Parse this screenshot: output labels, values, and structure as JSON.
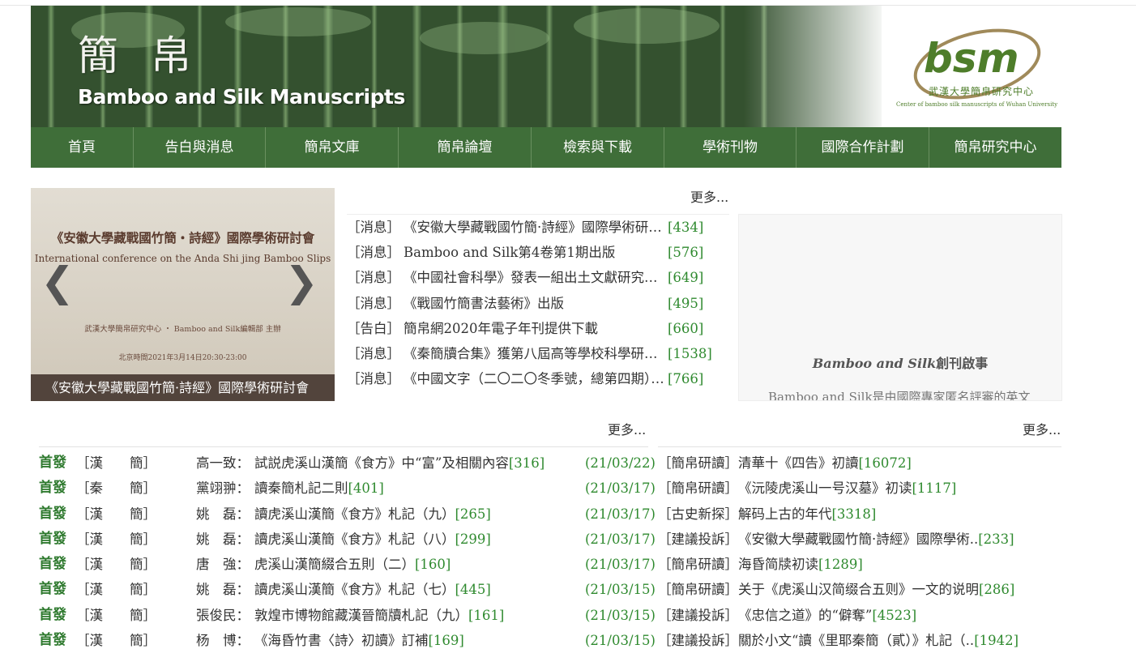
{
  "banner": {
    "title_cn": "簡帛",
    "title_en": "Bamboo and Silk Manuscripts",
    "logo_text": "bsm",
    "logo_cn": "武漢大學簡帛研究中心",
    "logo_en": "Center of bamboo silk manuscripts of Wuhan University"
  },
  "nav": [
    "首頁",
    "告白與消息",
    "簡帛文庫",
    "簡帛論壇",
    "檢索與下載",
    "學術刊物",
    "國際合作計劃",
    "簡帛研究中心"
  ],
  "slider": {
    "title": "《安徽大學藏戰國竹簡・詩經》國際學術研討會",
    "subtitle": "International conference on the Anda Shi jing Bamboo Slips",
    "org": "武漢大學簡帛研究中心 ・ Bamboo and Silk編輯部 主辦",
    "time": "北京時間2021年3月14日20:30-23:00",
    "caption": "《安徽大學藏戰國竹簡·詩經》國際學術研討會",
    "prev": "❮",
    "next": "❯"
  },
  "news": {
    "more": "更多...",
    "items": [
      {
        "tag": "［消息］",
        "title": "《安徽大學藏戰國竹簡·詩經》國際學術研討會",
        "count": "[434]"
      },
      {
        "tag": "［消息］",
        "title": "Bamboo and Silk第4卷第1期出版",
        "count": "[576]"
      },
      {
        "tag": "［消息］",
        "title": "《中國社會科學》發表一組出土文獻研究論文",
        "count": "[649]"
      },
      {
        "tag": "［消息］",
        "title": "《戰國竹簡書法藝術》出版",
        "count": "[495]"
      },
      {
        "tag": "［告白］",
        "title": "簡帛網2020年電子年刊提供下載",
        "count": "[660]"
      },
      {
        "tag": "［消息］",
        "title": "《秦簡牘合集》獲第八屆高等學校科學研究優秀成果獎",
        "count": "[1538]"
      },
      {
        "tag": "［消息］",
        "title": "《中國文字（二〇二〇冬季號，總第四期）》出版",
        "count": "[766]"
      }
    ]
  },
  "notice": {
    "title_italic": "Bamboo and Silk",
    "title_rest": "創刊啟事",
    "text": "Bamboo and Silk是由國際專家匿名評審的英文"
  },
  "left_list": {
    "more": "更多...",
    "first_label": "首發",
    "items": [
      {
        "cat": "［漢　　簡］",
        "author": "高一致：",
        "title": "試説虎溪山漢簡《食方》中“富”及相關內容",
        "count": "[316]",
        "date": "(21/03/22)"
      },
      {
        "cat": "［秦　　簡］",
        "author": "黨翊翀：",
        "title": "讀秦簡札記二則",
        "count": "[401]",
        "date": "(21/03/17)"
      },
      {
        "cat": "［漢　　簡］",
        "author": "姚　磊：",
        "title": "讀虎溪山漢簡《食方》札記（九）",
        "count": "[265]",
        "date": "(21/03/17)"
      },
      {
        "cat": "［漢　　簡］",
        "author": "姚　磊：",
        "title": "讀虎溪山漢簡《食方》札記（八）",
        "count": "[299]",
        "date": "(21/03/17)"
      },
      {
        "cat": "［漢　　簡］",
        "author": "唐　強：",
        "title": "虎溪山漢簡綴合五則（二）",
        "count": "[160]",
        "date": "(21/03/17)"
      },
      {
        "cat": "［漢　　簡］",
        "author": "姚　磊：",
        "title": "讀虎溪山漢簡《食方》札記（七）",
        "count": "[445]",
        "date": "(21/03/15)"
      },
      {
        "cat": "［漢　　簡］",
        "author": "張俊民：",
        "title": "敦煌市博物館藏漢晉簡牘札記（九）",
        "count": "[161]",
        "date": "(21/03/15)"
      },
      {
        "cat": "［漢　　簡］",
        "author": "杨　博：",
        "title": "《海昏竹書〈詩〉初讀》訂補",
        "count": "[169]",
        "date": "(21/03/15)"
      }
    ]
  },
  "right_list": {
    "more": "更多...",
    "items": [
      {
        "tag": "［簡帛研讀］",
        "title": "清華十《四告》初讀",
        "count": "[16072]"
      },
      {
        "tag": "［簡帛研讀］",
        "title": "《沅陵虎溪山一号汉墓》初读",
        "count": "[1117]"
      },
      {
        "tag": "［古史新探］",
        "title": "解码上古的年代",
        "count": "[3318]"
      },
      {
        "tag": "［建議投訴］",
        "title": "《安徽大學藏戰國竹簡·詩經》國際學術..",
        "count": "[233]"
      },
      {
        "tag": "［簡帛研讀］",
        "title": "海昏简牍初读",
        "count": "[1289]"
      },
      {
        "tag": "［簡帛研讀］",
        "title": "关于《虎溪山汉简缀合五则》一文的说明",
        "count": "[286]"
      },
      {
        "tag": "［建議投訴］",
        "title": "《忠信之道》的“僻奪”",
        "count": "[4523]"
      },
      {
        "tag": "［建議投訴］",
        "title": "關於小文“讀《里耶秦簡（貳）》札記（..",
        "count": "[1942]"
      }
    ]
  }
}
